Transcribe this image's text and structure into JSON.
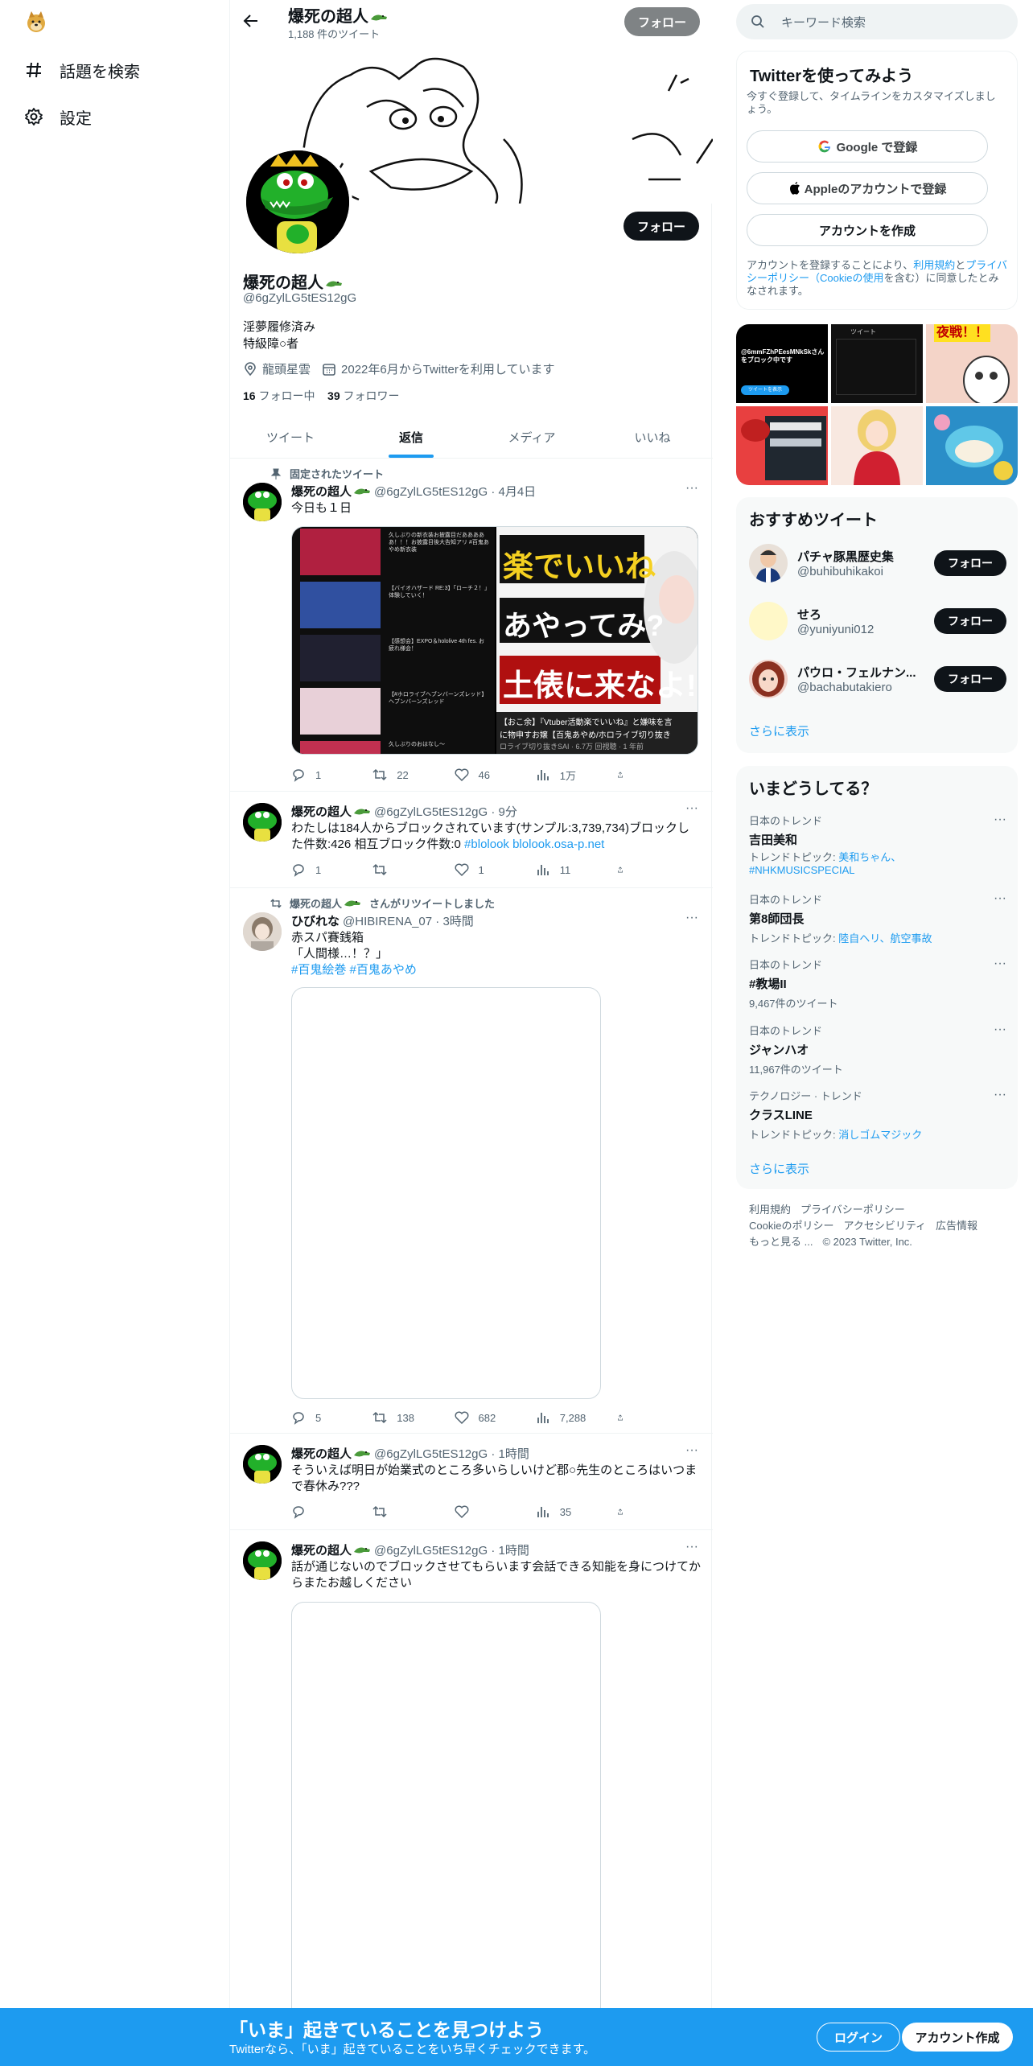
{
  "nav": {
    "items": [
      {
        "label": "話題を検索",
        "icon": "hashtag-icon"
      },
      {
        "label": "設定",
        "icon": "gear-icon"
      }
    ]
  },
  "header": {
    "name": "爆死の超人",
    "tweet_count": "1,188 件のツイート",
    "follow_label": "フォロー"
  },
  "profile": {
    "name": "爆死の超人",
    "handle": "@6gZylLG5tES12gG",
    "bio_line1": "淫夢履修済み",
    "bio_line2": "特級障○者",
    "location": "龍頭星雲",
    "joined": "2022年6月からTwitterを利用しています",
    "following_count": "16",
    "following_label": "フォロー中",
    "followers_count": "39",
    "followers_label": "フォロワー",
    "follow_label": "フォロー"
  },
  "tabs": [
    "ツイート",
    "返信",
    "メディア",
    "いいね"
  ],
  "tweets": [
    {
      "context": "固定されたツイート",
      "name": "爆死の超人",
      "meta": "@6gZylLG5tES12gG · 4月4日",
      "text": "今日も１日",
      "replies": "1",
      "retweets": "22",
      "likes": "46",
      "views": "1万"
    },
    {
      "name": "爆死の超人",
      "meta": "@6gZylLG5tES12gG · 9分",
      "text": "わたしは184人からブロックされています(サンプル:3,739,734)ブロックした件数:426 相互ブロック件数:0 ",
      "link": "#blolook blolook.osa-p.net",
      "replies": "1",
      "retweets": "",
      "likes": "1",
      "views": "11"
    },
    {
      "context": "爆死の超人",
      "context_suffix": "さんがリツイートしました",
      "name": "ひびれな",
      "meta": "@HIBIRENA_07 · 3時間",
      "text1": "赤スパ賽銭箱",
      "text2": "「人間様…！？」",
      "tags": "#百鬼絵巻 #百鬼あやめ",
      "replies": "5",
      "retweets": "138",
      "likes": "682",
      "views": "7,288"
    },
    {
      "name": "爆死の超人",
      "meta": "@6gZylLG5tES12gG · 1時間",
      "text": "そういえば明日が始業式のところ多いらしいけど郡○先生のところはいつまで春休み???",
      "replies": "",
      "retweets": "",
      "likes": "",
      "views": "35"
    },
    {
      "name": "爆死の超人",
      "meta": "@6gZylLG5tES12gG · 1時間",
      "text": "話が通じないのでブロックさせてもらいます会話できる知能を身につけてからまたお越しください"
    }
  ],
  "media_thumb": {
    "headline1": "楽でいいね",
    "headline2": "あやってみ?",
    "headline3": "土俵に来なよ!",
    "caption": "【おこ余】『Vtuber活動楽でいいね』と嫌味を言",
    "caption2": "に物申すお嬢【百鬼あやめ/ホロライブ切り抜き",
    "caption3": "ロライブ切り抜きSAI · 6.7万 回視聴 · 1 年前",
    "list": [
      "久しぶりの新衣装お披露目だあああああ！！！お披露目後大告知アリ #百鬼あやめ新衣装",
      "【バイオハザード RE:3】「ローチ２！」体験していく！",
      "【感想会】EXPO＆hololive 4th fes. お疲れ様会！",
      "【#ホロライブヘブンバーンズレッド】ヘブンバーンズレッド",
      "久しぶりのおはなし〜"
    ]
  },
  "search": {
    "placeholder": "キーワード検索"
  },
  "signup": {
    "title": "Twitterを使ってみよう",
    "subtitle": "今すぐ登録して、タイムラインをカスタマイズしましょう。",
    "google": "Google で登録",
    "apple": "Appleのアカウントで登録",
    "create": "アカウントを作成",
    "terms_prefix": "アカウントを登録することにより、",
    "terms_link1": "利用規約",
    "terms_mid": "と",
    "terms_link2": "プライバシーポリシー（Cookieの使用",
    "terms_suffix": "を含む）に同意したとみなされます。"
  },
  "media_grid": {
    "tile1": "@6mmFZhPEesMNkSkさんをブロック中です",
    "tile1b": "ツイートを表示",
    "tile2": "ツイート",
    "tile3": "夜戦！！"
  },
  "wtf": {
    "title": "おすすめツイート",
    "users": [
      {
        "name": "パチャ豚黒歴史集",
        "handle": "@buhibuhikakoi",
        "follow": "フォロー"
      },
      {
        "name": "せろ",
        "handle": "@yuniyuni012",
        "follow": "フォロー"
      },
      {
        "name": "パウロ・フェルナン...",
        "handle": "@bachabutakiero",
        "follow": "フォロー"
      }
    ],
    "more": "さらに表示"
  },
  "trends": {
    "title": "いまどうしてる？",
    "items": [
      {
        "context": "日本のトレンド",
        "name": "吉田美和",
        "sub_prefix": "トレンドトピック: ",
        "sub_link": "美和ちゃん、#NHKMUSICSPECIAL"
      },
      {
        "context": "日本のトレンド",
        "name": "第8師団長",
        "sub_prefix": "トレンドトピック: ",
        "sub_link": "陸自ヘリ、航空事故"
      },
      {
        "context": "日本のトレンド",
        "name": "#教場II",
        "sub_prefix": "9,467件のツイート",
        "sub_link": ""
      },
      {
        "context": "日本のトレンド",
        "name": "ジャンハオ",
        "sub_prefix": "11,967件のツイート",
        "sub_link": ""
      },
      {
        "context": "テクノロジー · トレンド",
        "name": "クラスLINE",
        "sub_prefix": "トレンドトピック: ",
        "sub_link": "消しゴムマジック"
      }
    ],
    "more": "さらに表示"
  },
  "footer": {
    "line1": [
      "利用規約",
      "プライバシーポリシー"
    ],
    "line2": [
      "Cookieのポリシー",
      "アクセシビリティ",
      "広告情報"
    ],
    "line3": [
      "もっと見る ...",
      "© 2023 Twitter, Inc."
    ]
  },
  "bottom": {
    "title": "「いま」起きていることを見つけよう",
    "subtitle": "Twitterなら、「いま」起きていることをいち早くチェックできます。",
    "login": "ログイン",
    "signup": "アカウント作成"
  },
  "colors": {
    "accent": "#1d9bf0",
    "text": "#0f1419",
    "muted": "#536471"
  }
}
